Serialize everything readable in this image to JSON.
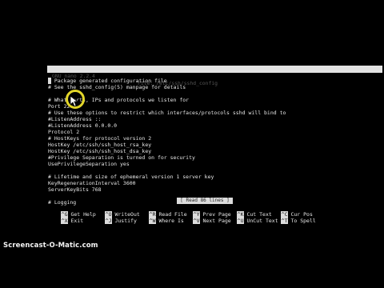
{
  "header": {
    "app_version": "GNU nano 2.2.4",
    "file_label": "File: /etc/ssh/sshd_config"
  },
  "editor_lines": [
    "# Package generated configuration file",
    "# See the sshd_config(5) manpage for details",
    "",
    "# What ports, IPs and protocols we listen for",
    "Port 22",
    "# Use these options to restrict which interfaces/protocols sshd will bind to",
    "#ListenAddress ::",
    "#ListenAddress 0.0.0.0",
    "Protocol 2",
    "# HostKeys for protocol version 2",
    "HostKey /etc/ssh/ssh_host_rsa_key",
    "HostKey /etc/ssh/ssh_host_dsa_key",
    "#Privilege Separation is turned on for security",
    "UsePrivilegeSeparation yes",
    "",
    "# Lifetime and size of ephemeral version 1 server key",
    "KeyRegenerationInterval 3600",
    "ServerKeyBits 768",
    "",
    "# Logging"
  ],
  "status_message": "[ Read 86 lines ]",
  "shortcuts": {
    "row1": [
      {
        "key": "^G",
        "label": "Get Help"
      },
      {
        "key": "^O",
        "label": "WriteOut"
      },
      {
        "key": "^R",
        "label": "Read File"
      },
      {
        "key": "^Y",
        "label": "Prev Page"
      },
      {
        "key": "^K",
        "label": "Cut Text"
      },
      {
        "key": "^C",
        "label": "Cur Pos"
      }
    ],
    "row2": [
      {
        "key": "^X",
        "label": "Exit"
      },
      {
        "key": "^J",
        "label": "Justify"
      },
      {
        "key": "^W",
        "label": "Where Is"
      },
      {
        "key": "^V",
        "label": "Next Page"
      },
      {
        "key": "^U",
        "label": "UnCut Text"
      },
      {
        "key": "^T",
        "label": "To Spell"
      }
    ]
  },
  "watermark": "Screencast-O-Matic.com",
  "colors": {
    "background": "#000000",
    "text": "#e6e6e6",
    "inverse_bar": "#dcdcdc",
    "mouse_highlight": "#e3d62a"
  },
  "icons": {
    "pointer": "mouse-pointer-icon",
    "highlight": "cursor-highlight-ring"
  }
}
